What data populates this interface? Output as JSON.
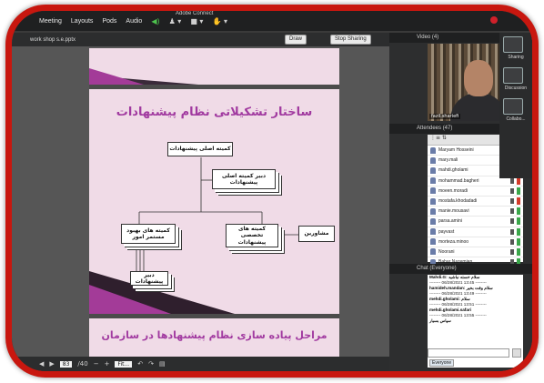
{
  "app": {
    "title": "Adobe Connect"
  },
  "menubar": {
    "items": [
      "Meeting",
      "Layouts",
      "Pods",
      "Audio"
    ]
  },
  "sharepod": {
    "filename": "work shop s.e.pptx",
    "buttons": [
      "Draw",
      "Stop Sharing"
    ]
  },
  "slides": {
    "slide2_title": "ساختار تشکیلاتی نظام پیشنهادات",
    "boxes": {
      "top": "کمیته اصلی پیشنهادات",
      "secretary": "دبیر کمیته اصلی پیشنهادات",
      "improve": "کمیته های بهبود مستمر امور",
      "specialist": "کمیته های تخصصی پیشنهادات",
      "consult": "مشاورین",
      "bottom": "دبیر پیشنهادات"
    },
    "slide3_title": "مراحل پیاده سازی نظام پیشنهادها در سازمان"
  },
  "toolbar": {
    "page": "83",
    "total": "/40",
    "zoom": "Fit..."
  },
  "video": {
    "label": "Video (4)",
    "speaker": "fazil.shariefi"
  },
  "attendees": {
    "label": "Attendees (47)",
    "rows": [
      {
        "name": "Maryam Hosseini",
        "status": "#3aa64a"
      },
      {
        "name": "mary.mali",
        "status": "#d43a2a"
      },
      {
        "name": "mahdi.gholami",
        "status": "#3aa64a"
      },
      {
        "name": "mohammad.bagheri",
        "status": "#d43a2a"
      },
      {
        "name": "moeen.moradi",
        "status": "#3aa64a"
      },
      {
        "name": "mostafa.khodadadi",
        "status": "#d43a2a"
      },
      {
        "name": "manie.mousavi",
        "status": "#3aa64a"
      },
      {
        "name": "parsa.amini",
        "status": "#3aa64a"
      },
      {
        "name": "payvast",
        "status": "#3aa64a"
      },
      {
        "name": "morteza.minoo",
        "status": "#3aa64a"
      },
      {
        "name": "Noorani",
        "status": "#3aa64a"
      },
      {
        "name": "Bahar Nazemian",
        "status": "#3aa64a"
      }
    ]
  },
  "chat": {
    "label": "Chat (Everyone)",
    "lines": [
      "Mahdi.G: سلام خسته نباشید",
      "-------- 06/28/2021 13:45 --------",
      "hamideh.mandan: سلام وقت بخیر",
      "-------- 06/28/2021 13:49 --------",
      "mehdi.gholami: سلام",
      "-------- 06/28/2021 13:51 --------",
      "mehdi.gholami.safari",
      "-------- 06/28/2021 13:55 --------",
      "سپاس بسیار"
    ],
    "tab": "Everyone"
  },
  "right_buttons": [
    "Sharing",
    "Discussion",
    "Collabo..."
  ]
}
